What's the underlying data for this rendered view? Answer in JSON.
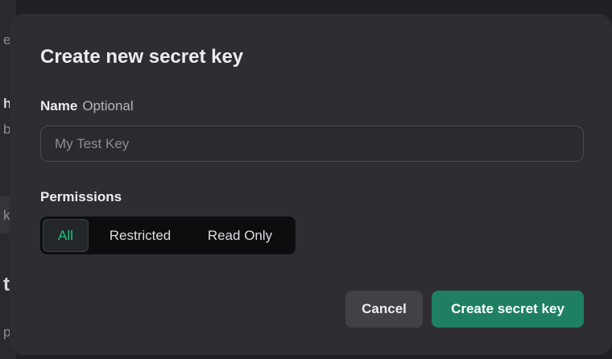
{
  "background": {
    "fragments": [
      "e",
      "h",
      "b",
      "k",
      "t",
      "p"
    ]
  },
  "modal": {
    "title": "Create new secret key",
    "name_field": {
      "label": "Name",
      "optional_label": "Optional",
      "placeholder": "My Test Key",
      "value": ""
    },
    "permissions": {
      "label": "Permissions",
      "options": [
        "All",
        "Restricted",
        "Read Only"
      ],
      "selected": "All"
    },
    "buttons": {
      "cancel": "Cancel",
      "create": "Create secret key"
    }
  },
  "colors": {
    "modal_bg": "#2d2d33",
    "accent_green": "#19c37d",
    "primary_button": "#1f7f62"
  }
}
